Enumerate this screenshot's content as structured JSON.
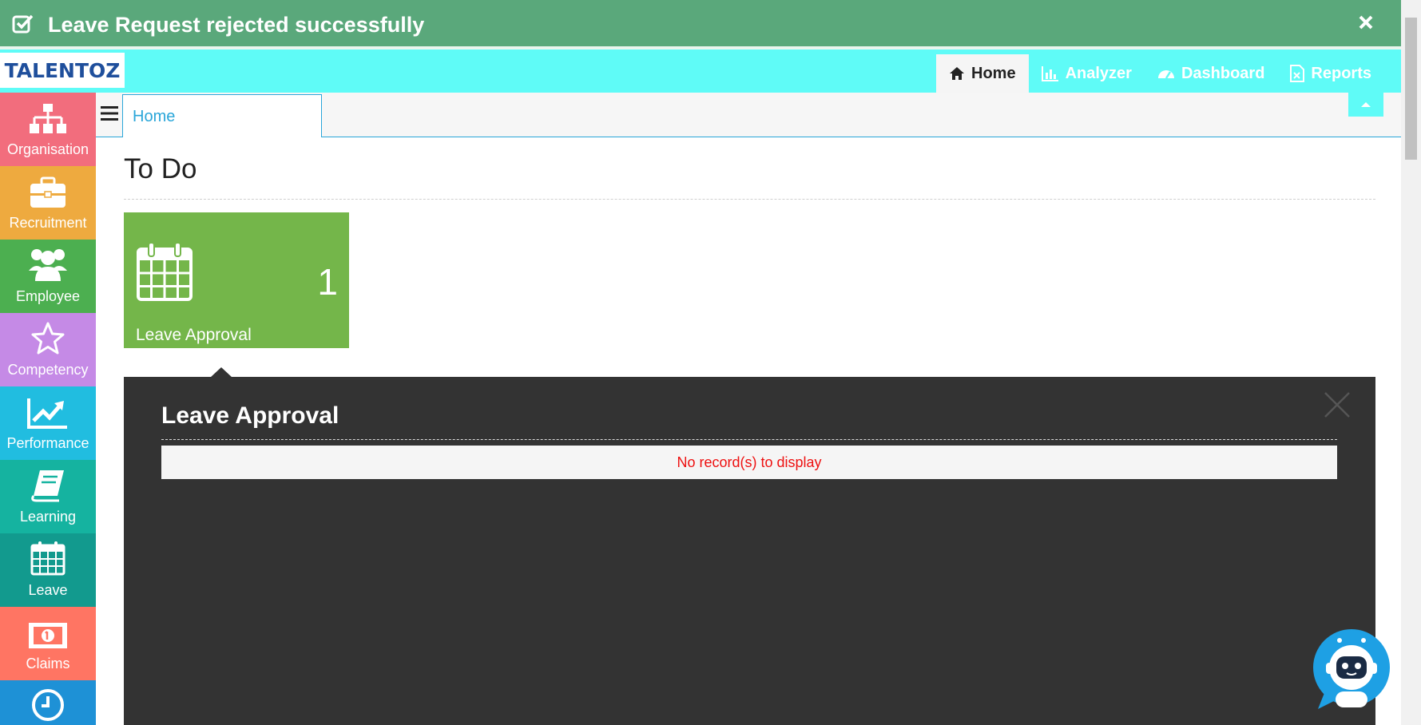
{
  "toast": {
    "message": "Leave Request rejected successfully",
    "check_icon": "check-square-icon",
    "close_icon": "close-icon",
    "color": "#5aa87b"
  },
  "header": {
    "logo_text": "TALENTOZ",
    "color": "#5ffbf7",
    "nav": [
      {
        "label": "Home",
        "icon": "home-icon",
        "active": true
      },
      {
        "label": "Analyzer",
        "icon": "bar-chart-icon"
      },
      {
        "label": "Dashboard",
        "icon": "dashboard-icon"
      },
      {
        "label": "Reports",
        "icon": "report-file-icon"
      }
    ]
  },
  "sidebar": {
    "items": [
      {
        "label": "Organisation",
        "icon": "org-chart-icon",
        "color": "#f26d7d"
      },
      {
        "label": "Recruitment",
        "icon": "briefcase-icon",
        "color": "#eeaa3f"
      },
      {
        "label": "Employee",
        "icon": "users-icon",
        "color": "#4caf50"
      },
      {
        "label": "Competency",
        "icon": "star-icon",
        "color": "#c58ae6"
      },
      {
        "label": "Performance",
        "icon": "trend-chart-icon",
        "color": "#21bde0"
      },
      {
        "label": "Learning",
        "icon": "book-icon",
        "color": "#15b3a0"
      },
      {
        "label": "Leave",
        "icon": "calendar-icon",
        "color": "#129a8e"
      },
      {
        "label": "Claims",
        "icon": "money-icon",
        "color": "#ff7563"
      },
      {
        "label": "",
        "icon": "clock-icon",
        "color": "#1e91d6"
      }
    ]
  },
  "breadcrumb": {
    "tab_label": "Home",
    "menu_icon": "hamburger-icon",
    "collapse_icon": "chevron-up-icon"
  },
  "main": {
    "title": "To Do",
    "tiles": [
      {
        "label": "Leave Approval",
        "count": "1",
        "icon": "calendar-icon",
        "color": "#74b64a"
      }
    ],
    "panel": {
      "title": "Leave Approval",
      "empty_message": "No record(s) to display",
      "close_icon": "close-icon"
    }
  },
  "chatbot": {
    "icon": "chatbot-robot-icon"
  }
}
